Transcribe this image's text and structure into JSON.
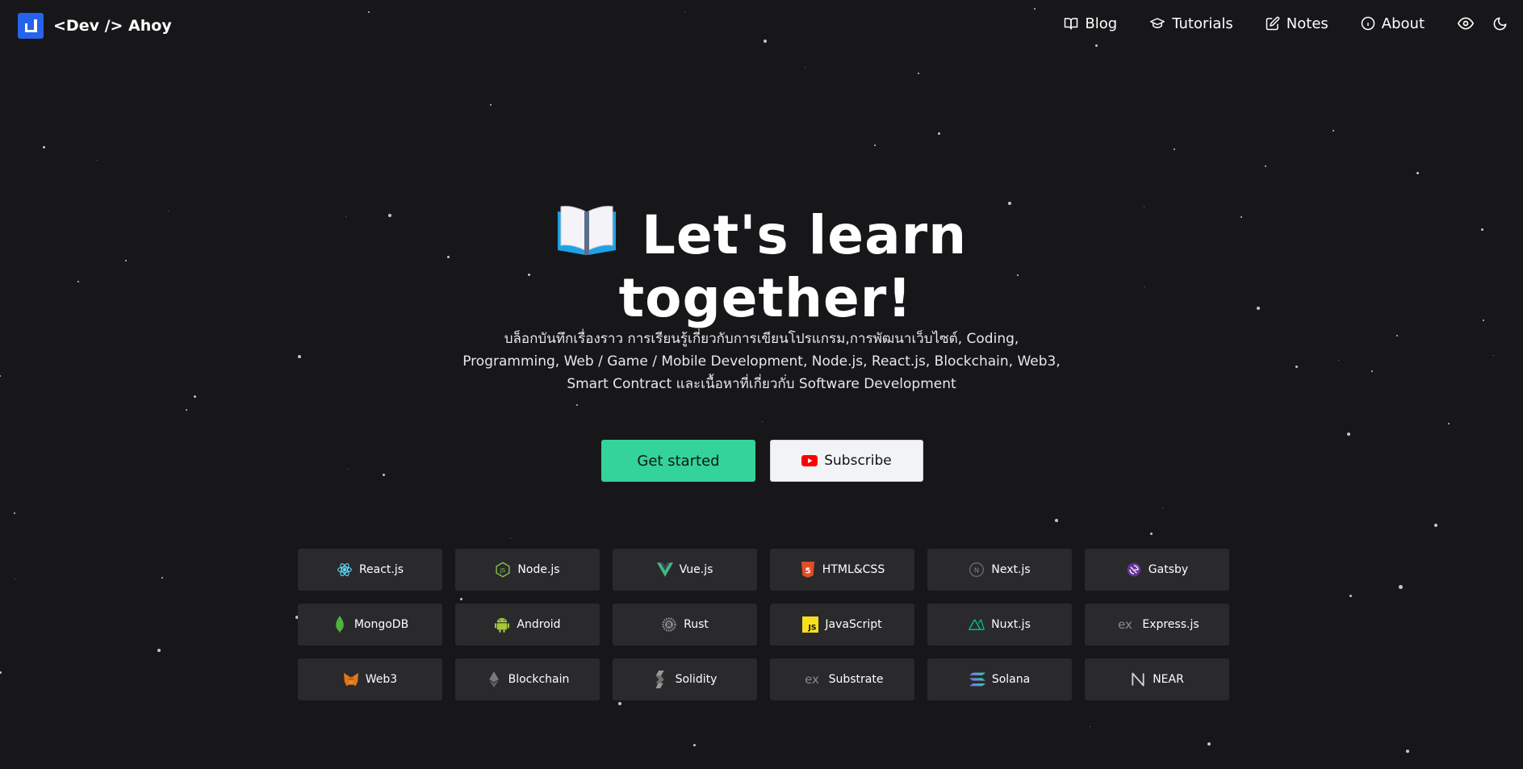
{
  "site": {
    "logo_text": "<Dev /> Ahoy"
  },
  "nav": {
    "items": [
      {
        "label": "Blog",
        "icon": "book-open-icon"
      },
      {
        "label": "Tutorials",
        "icon": "graduation-cap-icon"
      },
      {
        "label": "Notes",
        "icon": "edit-icon"
      },
      {
        "label": "About",
        "icon": "info-icon"
      }
    ],
    "actions": [
      {
        "icon": "eye-icon"
      },
      {
        "icon": "moon-icon"
      }
    ]
  },
  "hero": {
    "emoji_icon": "open-book-icon",
    "title_line1": "Let's learn",
    "title_line2": "together!",
    "description": "บล็อกบันทึกเรื่องราว การเรียนรู้เกี่ยวกับการเขียนโปรแกรม,การพัฒนาเว็บไซต์, Coding, Programming, Web / Game / Mobile Development, Node.js, React.js, Blockchain, Web3, Smart Contract และเนื้อหาที่เกี่ยวกับ Software Development"
  },
  "buttons": {
    "get_started": "Get started",
    "subscribe": "Subscribe"
  },
  "tech": [
    {
      "label": "React.js",
      "icon": "react-icon",
      "color": "#61dafb"
    },
    {
      "label": "Node.js",
      "icon": "nodejs-icon",
      "color": "#8cc84b"
    },
    {
      "label": "Vue.js",
      "icon": "vue-icon",
      "color": "#41b883"
    },
    {
      "label": "HTML&CSS",
      "icon": "html5-icon",
      "color": "#e44d26"
    },
    {
      "label": "Next.js",
      "icon": "nextjs-icon",
      "color": "#888888"
    },
    {
      "label": "Gatsby",
      "icon": "gatsby-icon",
      "color": "#663399"
    },
    {
      "label": "MongoDB",
      "icon": "mongodb-icon",
      "color": "#4db33d"
    },
    {
      "label": "Android",
      "icon": "android-icon",
      "color": "#a4c639"
    },
    {
      "label": "Rust",
      "icon": "rust-icon",
      "color": "#9a9a9a"
    },
    {
      "label": "JavaScript",
      "icon": "javascript-icon",
      "color": "#f7df1e"
    },
    {
      "label": "Nuxt.js",
      "icon": "nuxt-icon",
      "color": "#00c58e"
    },
    {
      "label": "Express.js",
      "icon": "express-icon",
      "color": "#8a8a8a"
    },
    {
      "label": "Web3",
      "icon": "metamask-icon",
      "color": "#f6851b"
    },
    {
      "label": "Blockchain",
      "icon": "ethereum-icon",
      "color": "#8a8a8a"
    },
    {
      "label": "Solidity",
      "icon": "solidity-icon",
      "color": "#9a9a9a"
    },
    {
      "label": "Substrate",
      "icon": "substrate-icon",
      "color": "#8a8a8a"
    },
    {
      "label": "Solana",
      "icon": "solana-icon",
      "color": "#9945ff"
    },
    {
      "label": "NEAR",
      "icon": "near-icon",
      "color": "#cfd3dc"
    }
  ],
  "colors": {
    "background": "#17171a",
    "accent_green": "#34d399",
    "logo_blue": "#2563eb",
    "tile": "#2a2a2d",
    "youtube_red": "#ff0000"
  }
}
